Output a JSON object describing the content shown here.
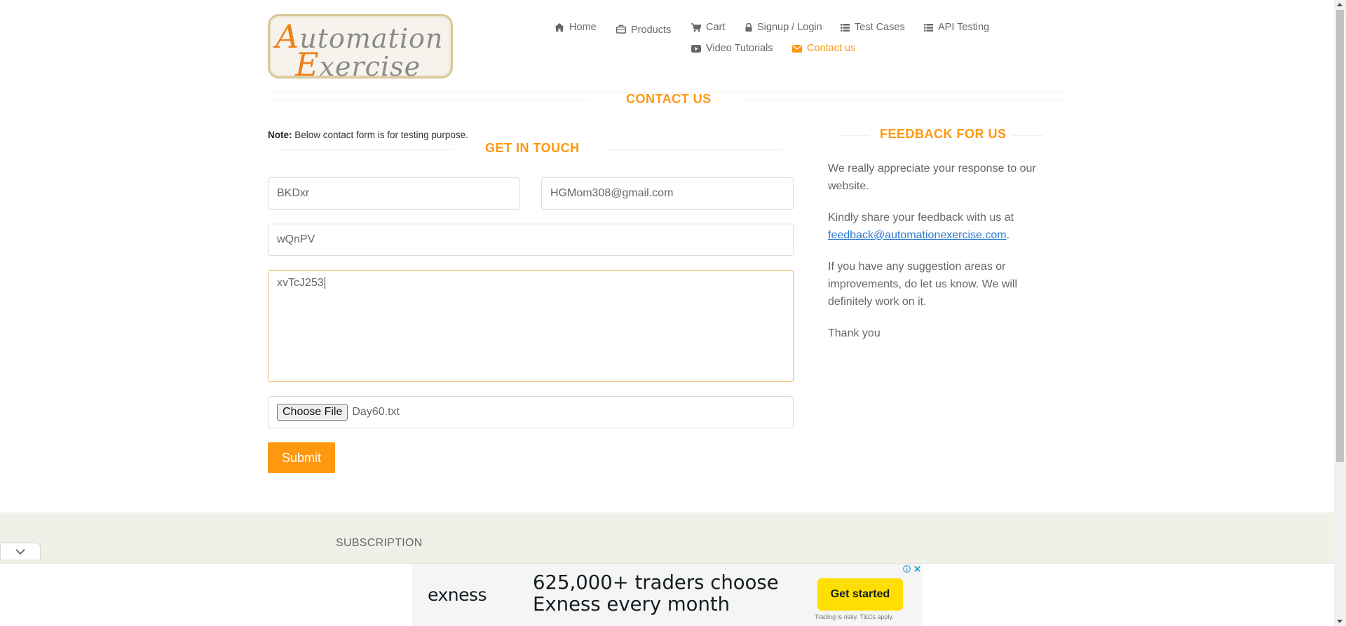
{
  "logo": {
    "line1_cap": "A",
    "line1_rest": "utomation",
    "line2_cap": "E",
    "line2_rest": "xercise"
  },
  "nav": {
    "home": "Home",
    "products": "Products",
    "cart": "Cart",
    "signup": "Signup / Login",
    "test_cases": "Test Cases",
    "api_testing": "API Testing",
    "video_tutorials": "Video Tutorials",
    "contact_us": "Contact us"
  },
  "page_title": "CONTACT US",
  "note": {
    "label": "Note:",
    "text": " Below contact form is for testing purpose."
  },
  "form": {
    "title": "GET IN TOUCH",
    "name_value": "BKDxr",
    "email_value": "HGMom308@gmail.com",
    "subject_value": "wQnPV",
    "message_value": "xvTcJ253",
    "file_button": "Choose File",
    "file_name": "Day60.txt",
    "submit_label": "Submit"
  },
  "feedback": {
    "title": "FEEDBACK FOR US",
    "p1": "We really appreciate your response to our website.",
    "p2_text": "Kindly share your feedback with us at ",
    "p2_link": "feedback@automationexercise.com",
    "p2_end": ".",
    "p3": "If you have any suggestion areas or improvements, do let us know. We will definitely work on it.",
    "p4": "Thank you"
  },
  "footer": {
    "subscription_title": "SUBSCRIPTION"
  },
  "ad": {
    "brand": "exness",
    "headline": "625,000+ traders choose Exness every month",
    "cta": "Get started",
    "disclaimer": "Trading is risky. T&Cs apply."
  },
  "colors": {
    "accent": "#fe980f",
    "link": "#2a7ad0",
    "ad_cta": "#ffde02"
  }
}
